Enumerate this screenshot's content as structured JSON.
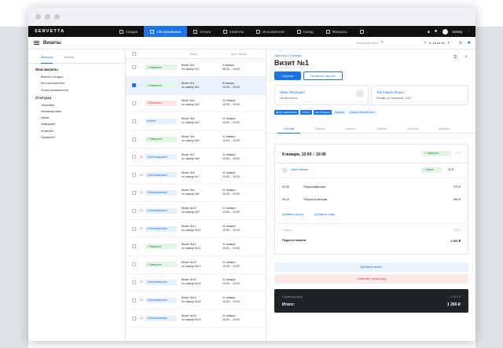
{
  "app": {
    "brand": "SERVETTA",
    "user": "Dmitry"
  },
  "nav": [
    {
      "label": "Сводка",
      "icon": "dashboard-icon"
    },
    {
      "label": "Обслуживание",
      "icon": "service-icon",
      "active": true
    },
    {
      "label": "Услуги",
      "icon": "tools-icon"
    },
    {
      "label": "Клиенты",
      "icon": "clients-icon"
    },
    {
      "label": "Исполнители",
      "icon": "people-icon"
    },
    {
      "label": "Склад",
      "icon": "warehouse-icon"
    },
    {
      "label": "Финансы",
      "icon": "finance-icon"
    },
    {
      "label": "↓",
      "icon": "more-icon"
    }
  ],
  "toolbar": {
    "title": "Визиты",
    "search_placeholder": "Быстрый поиск",
    "pager": "0–16 из 16"
  },
  "sidebar": {
    "tabs": [
      "Фильтры",
      "Фильтр"
    ],
    "my_visits_heading": "Мои визиты",
    "my_visits": [
      "Визиты сегодня",
      "Без исполнителя",
      "Отказ исполнителя"
    ],
    "status_heading": "Статусы",
    "statuses": [
      "Черновик",
      "Запланирован",
      "Начат",
      "Завершен",
      "Отменен",
      "Провален"
    ]
  },
  "list": {
    "headers": [
      "Визит",
      "Дата / время"
    ],
    "rows": [
      {
        "status": "Завершен",
        "kind": "done",
        "title": "Визит №2",
        "sub": "по заказу №1",
        "date": "4 января",
        "time": "08:30 – 18:00",
        "warn": false,
        "selected": false
      },
      {
        "status": "Завершен",
        "kind": "done",
        "title": "Визит №1",
        "sub": "по заказу №1",
        "date": "8 января",
        "time": "10:00 – 10:40",
        "warn": false,
        "selected": true
      },
      {
        "status": "Провален",
        "kind": "miss",
        "title": "Визит №3",
        "sub": "по заказу №3",
        "date": "11 января",
        "time": "10:00 – 10:00",
        "warn": false,
        "selected": false
      },
      {
        "status": "Начат",
        "kind": "new",
        "title": "Визит №5",
        "sub": "по заказу №5",
        "date": "11 января",
        "time": "10:00 – 10:00",
        "warn": false,
        "selected": false
      },
      {
        "status": "Завершен",
        "kind": "done",
        "title": "Визит №6",
        "sub": "по заказу №6",
        "date": "11 января",
        "time": "10:00 – 10:00",
        "warn": false,
        "selected": false
      },
      {
        "status": "Запланирован",
        "kind": "plan",
        "title": "Визит №7",
        "sub": "по заказу №6",
        "date": "11 января",
        "time": "10:00 – 10:00",
        "warn": true,
        "selected": false
      },
      {
        "status": "Запланирован",
        "kind": "plan",
        "title": "Визит №8",
        "sub": "по заказу №7",
        "date": "11 января",
        "time": "10:00 – 10:00",
        "warn": true,
        "selected": false
      },
      {
        "status": "Запланирован",
        "kind": "plan",
        "title": "Визит №9",
        "sub": "по заказу №8",
        "date": "11 января",
        "time": "10:00 – 10:00",
        "warn": true,
        "selected": false
      },
      {
        "status": "Запланирован",
        "kind": "plan",
        "title": "Визит №10",
        "sub": "по заказу №9",
        "date": "11 января",
        "time": "10:00 – 10:00",
        "warn": true,
        "selected": false
      },
      {
        "status": "Запланирован",
        "kind": "plan",
        "title": "Визит №11",
        "sub": "по заказу №10",
        "date": "11 января",
        "time": "10:00 – 10:00",
        "warn": true,
        "selected": false
      },
      {
        "status": "Завершен",
        "kind": "done",
        "title": "Визит №12",
        "sub": "по заказу №11",
        "date": "11 января",
        "time": "10:00 – 10:00",
        "warn": false,
        "selected": false
      },
      {
        "status": "Завершен",
        "kind": "done",
        "title": "Визит №13",
        "sub": "по заказу №12",
        "date": "11 января",
        "time": "10:00 – 10:00",
        "warn": false,
        "selected": false
      },
      {
        "status": "Запланирован",
        "kind": "plan",
        "title": "Визит №14",
        "sub": "по заказу №13",
        "date": "11 января",
        "time": "10:00 – 10:00",
        "warn": true,
        "selected": false
      },
      {
        "status": "Запланирован",
        "kind": "plan",
        "title": "Визит №15",
        "sub": "по заказу №14",
        "date": "11 января",
        "time": "10:00 – 10:00",
        "warn": true,
        "selected": false
      },
      {
        "status": "Запланирован",
        "kind": "plan",
        "title": "Визит №16",
        "sub": "по заказу №15",
        "date": "11 января",
        "time": "10:00 – 10:00",
        "warn": true,
        "selected": false
      }
    ]
  },
  "detail": {
    "breadcrumb": "Заказ №1 от 5 января",
    "title": "Визит №1",
    "btn_primary": "Оценка",
    "btn_secondary": "Оплатить чек сит",
    "client_name": "Иван Петрович",
    "client_email": "ivan@dummi.ru",
    "object_name": "Тестовый объект",
    "object_address": "Москва, ул Пожарская, 124/1",
    "tags": [
      "ДЕЛО ЗАВЕРШЕНО",
      "ОПЛАЧ.",
      "ВЫПОЛНЕНО",
      "ОЦЕНЕН",
      "ОЦЕНКА ОБРАБОТАНА"
    ],
    "tabs": [
      "Состав",
      "Расход",
      "Клиент",
      "Объект",
      "Оценка",
      "Журнал"
    ],
    "card_date": "8 января, 10:00 – 10:40",
    "card_status": "Завершен",
    "worker": "Иван Иванов",
    "worker_status": "Принят",
    "worker_sum": "40 ₽",
    "services": [
      {
        "time": "00:30",
        "name": "Уборка квартиры",
        "price": "270 ₽"
      },
      {
        "time": "00:10",
        "name": "Уборка по метрам",
        "price": "990 ₽"
      }
    ],
    "add_service": "Добавить услугу",
    "add_product": "Добавить товар",
    "discount_label": "Скидка",
    "discount_value": "140 ₽",
    "subtotal_label": "Подытог визита",
    "subtotal_value": "1 260 ₽",
    "add_visit": "Добавить визит",
    "cancel_promo": "Отменить промо-код",
    "promo_label": "Промокод (test)",
    "promo_value": "-2 610 ₽",
    "total_label": "Итого:",
    "total_value": "1 260 ₽"
  }
}
